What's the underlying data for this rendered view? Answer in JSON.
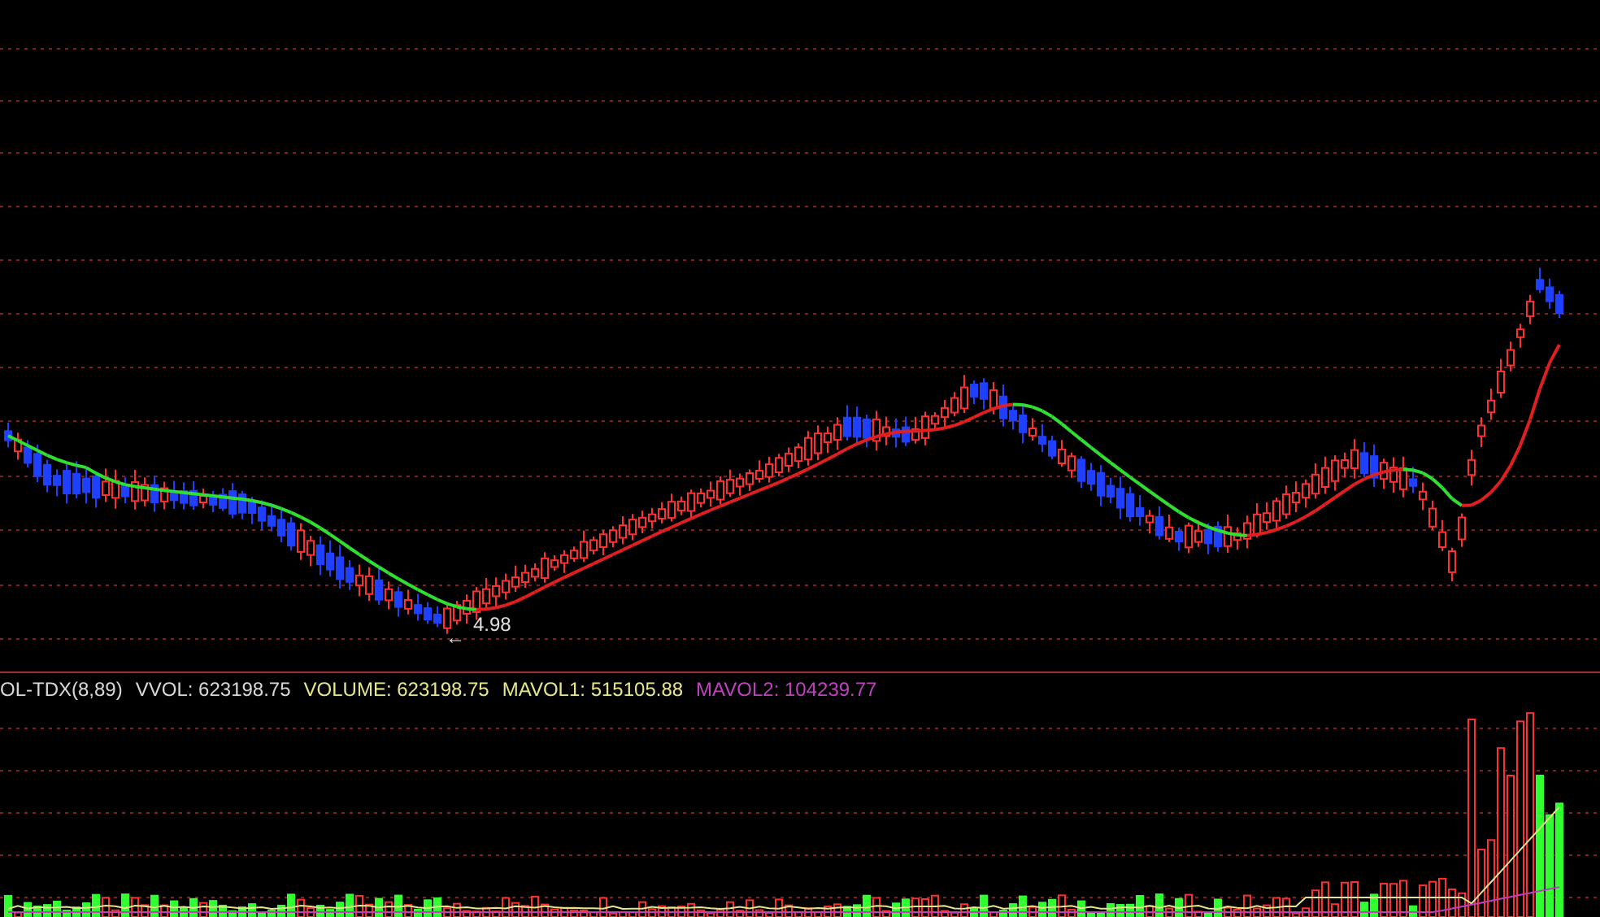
{
  "price_panel": {
    "low_marker": {
      "price": "4.98",
      "arrow": "←"
    }
  },
  "indicator_bar": {
    "items": [
      {
        "text": "OL-TDX(8,89)",
        "color": "#d8d8d8"
      },
      {
        "text": "VVOL: 623198.75",
        "color": "#d8d8d8"
      },
      {
        "text": "VOLUME: 623198.75",
        "color": "#e6e68c"
      },
      {
        "text": "MAVOL1: 515105.88",
        "color": "#e6e68c"
      },
      {
        "text": "MAVOL2: 104239.77",
        "color": "#c040c0"
      }
    ]
  }
}
